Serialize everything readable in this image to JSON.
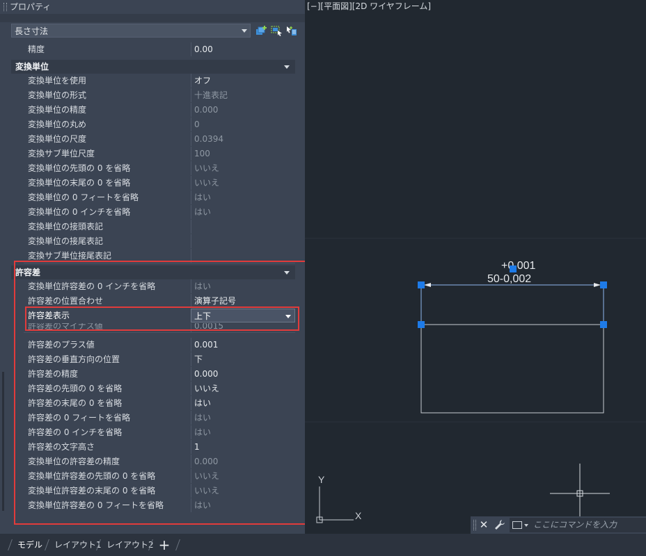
{
  "panel": {
    "title": "プロパティ",
    "object_type": "長さ寸法",
    "top_row": {
      "label": "精度",
      "value": "0.00"
    },
    "sections": [
      {
        "title": "変換単位",
        "rows": [
          {
            "label": "変換単位を使用",
            "value": "オフ",
            "dim": false
          },
          {
            "label": "変換単位の形式",
            "value": "十進表記",
            "dim": true
          },
          {
            "label": "変換単位の精度",
            "value": "0.000",
            "dim": true
          },
          {
            "label": "変換単位の丸め",
            "value": "0",
            "dim": true
          },
          {
            "label": "変換単位の尺度",
            "value": "0.0394",
            "dim": true
          },
          {
            "label": "変換サブ単位尺度",
            "value": "100",
            "dim": true
          },
          {
            "label": "変換単位の先頭の 0 を省略",
            "value": "いいえ",
            "dim": true
          },
          {
            "label": "変換単位の末尾の 0 を省略",
            "value": "いいえ",
            "dim": true
          },
          {
            "label": "変換単位の 0 フィートを省略",
            "value": "はい",
            "dim": true
          },
          {
            "label": "変換単位の 0 インチを省略",
            "value": "はい",
            "dim": true
          },
          {
            "label": "変換単位の接頭表記",
            "value": "",
            "dim": true
          },
          {
            "label": "変換単位の接尾表記",
            "value": "",
            "dim": true
          },
          {
            "label": "変換サブ単位接尾表記",
            "value": "",
            "dim": true
          }
        ]
      },
      {
        "title": "許容差",
        "rows": [
          {
            "label": "変換単位許容差の 0 インチを省略",
            "value": "はい",
            "dim": true
          },
          {
            "label": "許容差の位置合わせ",
            "value": "演算子記号",
            "dim": false
          },
          {
            "label": "許容差表示",
            "value": "上下",
            "dim": false,
            "active": true
          },
          {
            "label": "許容差のマイナス値",
            "value": "0.0015",
            "dim": true
          },
          {
            "label": "許容差のプラス値",
            "value": "0.001",
            "dim": false
          },
          {
            "label": "許容差の垂直方向の位置",
            "value": "下",
            "dim": false
          },
          {
            "label": "許容差の精度",
            "value": "0.000",
            "dim": false
          },
          {
            "label": "許容差の先頭の 0 を省略",
            "value": "いいえ",
            "dim": false
          },
          {
            "label": "許容差の末尾の 0 を省略",
            "value": "はい",
            "dim": false
          },
          {
            "label": "許容差の 0 フィートを省略",
            "value": "はい",
            "dim": true
          },
          {
            "label": "許容差の 0 インチを省略",
            "value": "はい",
            "dim": true
          },
          {
            "label": "許容差の文字高さ",
            "value": "1",
            "dim": false
          },
          {
            "label": "変換単位の許容差の精度",
            "value": "0.000",
            "dim": true
          },
          {
            "label": "変換単位許容差の先頭の 0 を省略",
            "value": "いいえ",
            "dim": true
          },
          {
            "label": "変換単位許容差の末尾の 0 を省略",
            "value": "いいえ",
            "dim": true
          },
          {
            "label": "変換単位許容差の 0 フィートを省略",
            "value": "はい",
            "dim": true
          }
        ]
      }
    ]
  },
  "viewport": {
    "label": "[−][平面図][2D ワイヤフレーム]",
    "dimension_upper": "+0,001",
    "dimension_lower": "50-0,002",
    "ucs_x": "X",
    "ucs_y": "Y"
  },
  "commandline": {
    "close_glyph": "✕",
    "placeholder": "ここにコマンドを入力"
  },
  "tabs": [
    {
      "label": "モデル",
      "active": true
    },
    {
      "label": "レイアウト1",
      "active": false
    },
    {
      "label": "レイアウト2",
      "active": false
    }
  ],
  "tab_add_glyph": "+",
  "colors": {
    "highlight": "#e23b3b",
    "grip": "#1e7be8",
    "drawing_lines": "#c8ccd2"
  },
  "icons": [
    "quick-select-icon",
    "select-objects-icon",
    "toggle-pickadd-icon",
    "wrench-icon",
    "command-prompt-icon"
  ]
}
